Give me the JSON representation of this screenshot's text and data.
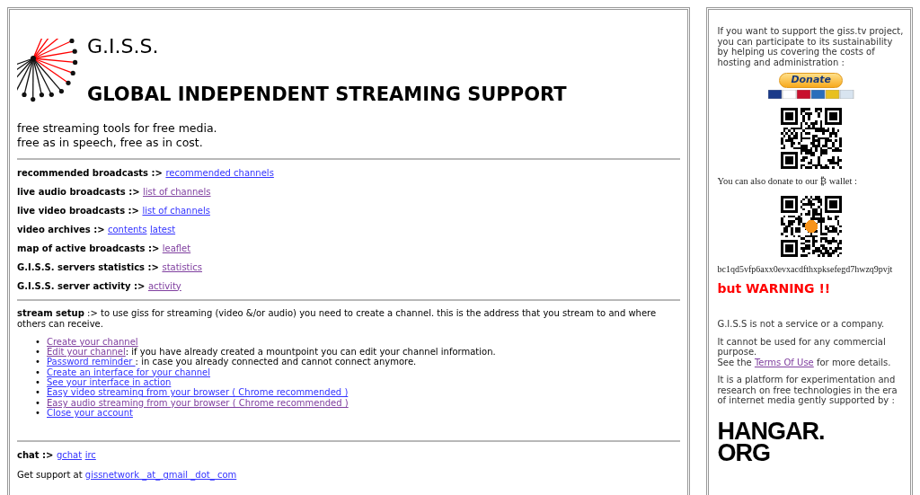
{
  "logo": {
    "short_name": "G.I.S.S.",
    "full_name": "GLOBAL INDEPENDENT STREAMING SUPPORT"
  },
  "tagline": [
    "free streaming tools for free media.",
    "free as in speech, free as in cost."
  ],
  "sections": [
    {
      "label": "recommended broadcasts :>",
      "links": [
        {
          "text": "recommended channels",
          "visited": false
        }
      ]
    },
    {
      "label": "live audio broadcasts :>",
      "links": [
        {
          "text": "list of channels",
          "visited": true
        }
      ]
    },
    {
      "label": "live video broadcasts :>",
      "links": [
        {
          "text": "list of channels",
          "visited": false
        }
      ]
    },
    {
      "label": "video archives :>",
      "links": [
        {
          "text": "contents",
          "visited": false
        },
        {
          "text": "latest",
          "visited": false
        }
      ]
    },
    {
      "label": "map of active broadcasts :>",
      "links": [
        {
          "text": "leaflet",
          "visited": true
        }
      ]
    },
    {
      "label": "G.I.S.S. servers statistics :>",
      "links": [
        {
          "text": "statistics",
          "visited": true
        }
      ]
    },
    {
      "label": "G.I.S.S. server activity :>",
      "links": [
        {
          "text": "activity",
          "visited": true
        }
      ]
    }
  ],
  "stream_setup": {
    "label": "stream setup",
    "text": ":> to use giss for streaming (video &/or audio) you need to create a channel. this is the address that you stream to and where others can receive.",
    "items": [
      {
        "bullet": "•",
        "link": "Create your channel",
        "visited": true
      },
      {
        "bullet": "•",
        "link": "Edit your channel",
        "visited": true,
        "note": ": if you have already created a mountpoint you can edit your channel information."
      },
      {
        "bullet": "•",
        "link": "Password reminder ",
        "visited": false,
        "note": ": in case you already connected and cannot connect anymore."
      },
      {
        "bullet": "•",
        "link": "Create an interface for your channel",
        "visited": false
      },
      {
        "bullet": "•",
        "link": "See your interface in action",
        "visited": false
      },
      {
        "bullet": "•",
        "link": "Easy video streaming from your browser ( Chrome recommended )",
        "visited": false
      },
      {
        "bullet": "•",
        "link": "Easy audio streaming from your browser ( Chrome recommended )",
        "visited": true
      },
      {
        "bullet": "•",
        "link": "Close your account",
        "visited": false
      }
    ]
  },
  "chat": {
    "label": "chat :>",
    "links": [
      {
        "text": "gchat",
        "visited": false
      },
      {
        "text": "irc",
        "visited": false
      }
    ]
  },
  "support": {
    "text": "Get support at",
    "link": "gissnetwork _at_ gmail _dot_ com",
    "visited": false
  },
  "sidebar": {
    "intro": "If you want to support the giss.tv project, you can participate to its sustainability by helping us covering the costs of hosting and administration :",
    "donate_button": "Donate",
    "bitcoin_text": "You can also donate to our ₿ wallet :",
    "bitcoin_address": "bc1qd5vfp6axx0evxacdfthxpksefegd7hwzq9pvjt",
    "warning": "but WARNING !!",
    "notes": [
      "G.I.S.S is not a service or a company.",
      "It cannot be used for any commercial purpose."
    ],
    "terms": {
      "before": "See the",
      "link": "Terms Of Use",
      "visited": true,
      "after": "for more details."
    },
    "platform": "It is a platform for experimentation and research on free technologies in the era of internet media gently supported by :",
    "sponsor": [
      "HANGAR.",
      "ORG"
    ]
  }
}
